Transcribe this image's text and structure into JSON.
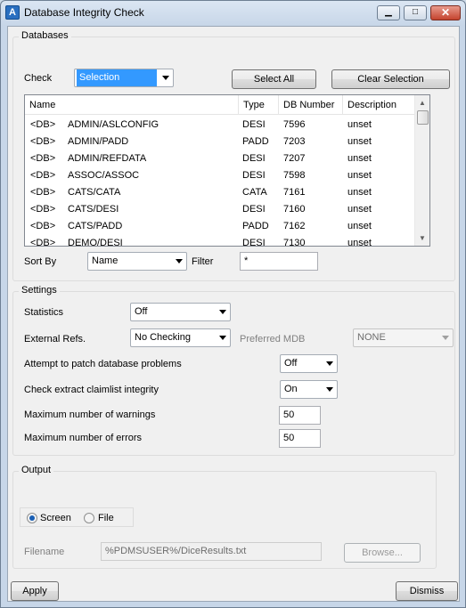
{
  "window": {
    "title": "Database Integrity Check",
    "app_icon": "A",
    "minimize_glyph": "▁",
    "maximize_glyph": "□",
    "close_glyph": "✕"
  },
  "databases": {
    "group_label": "Databases",
    "check_label": "Check",
    "check_value": "Selection",
    "select_all": "Select All",
    "clear_selection": "Clear Selection",
    "columns": [
      "Name",
      "Type",
      "DB Number",
      "Description"
    ],
    "rows": [
      {
        "prefix": "<DB>",
        "name": "ADMIN/ASLCONFIG",
        "type": "DESI",
        "number": "7596",
        "description": "unset"
      },
      {
        "prefix": "<DB>",
        "name": "ADMIN/PADD",
        "type": "PADD",
        "number": "7203",
        "description": "unset"
      },
      {
        "prefix": "<DB>",
        "name": "ADMIN/REFDATA",
        "type": "DESI",
        "number": "7207",
        "description": "unset"
      },
      {
        "prefix": "<DB>",
        "name": "ASSOC/ASSOC",
        "type": "DESI",
        "number": "7598",
        "description": "unset"
      },
      {
        "prefix": "<DB>",
        "name": "CATS/CATA",
        "type": "CATA",
        "number": "7161",
        "description": "unset"
      },
      {
        "prefix": "<DB>",
        "name": "CATS/DESI",
        "type": "DESI",
        "number": "7160",
        "description": "unset"
      },
      {
        "prefix": "<DB>",
        "name": "CATS/PADD",
        "type": "PADD",
        "number": "7162",
        "description": "unset"
      },
      {
        "prefix": "<DB>",
        "name": "DEMO/DESI",
        "type": "DESI",
        "number": "7130",
        "description": "unset"
      }
    ],
    "sort_by_label": "Sort By",
    "sort_by_value": "Name",
    "filter_label": "Filter",
    "filter_value": "*"
  },
  "settings": {
    "group_label": "Settings",
    "statistics_label": "Statistics",
    "statistics_value": "Off",
    "external_refs_label": "External Refs.",
    "external_refs_value": "No Checking",
    "preferred_mdb_label": "Preferred MDB",
    "preferred_mdb_value": "NONE",
    "patch_label": "Attempt to patch database problems",
    "patch_value": "Off",
    "claimlist_label": "Check extract claimlist integrity",
    "claimlist_value": "On",
    "max_warnings_label": "Maximum number of warnings",
    "max_warnings_value": "50",
    "max_errors_label": "Maximum number of errors",
    "max_errors_value": "50"
  },
  "output": {
    "group_label": "Output",
    "screen_label": "Screen",
    "file_label": "File",
    "selected": "Screen",
    "filename_label": "Filename",
    "filename_value": "%PDMSUSER%/DiceResults.txt",
    "browse": "Browse..."
  },
  "footer": {
    "apply": "Apply",
    "dismiss": "Dismiss"
  }
}
